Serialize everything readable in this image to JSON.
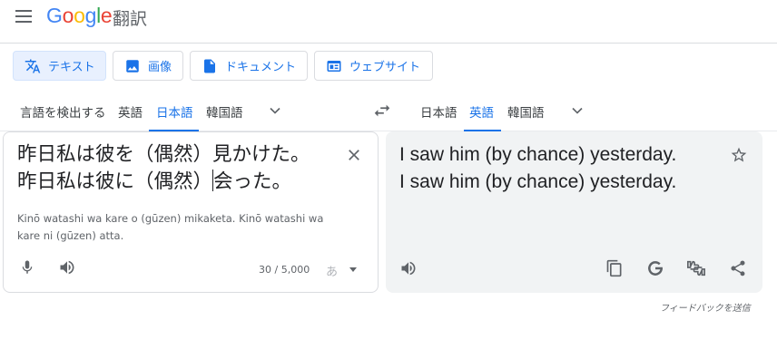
{
  "header": {
    "logo": [
      "G",
      "o",
      "o",
      "g",
      "l",
      "e"
    ],
    "app_name": "翻訳"
  },
  "modes": [
    {
      "label": "テキスト",
      "icon": "translate-icon",
      "active": true
    },
    {
      "label": "画像",
      "icon": "image-icon",
      "active": false
    },
    {
      "label": "ドキュメント",
      "icon": "document-icon",
      "active": false
    },
    {
      "label": "ウェブサイト",
      "icon": "website-icon",
      "active": false
    }
  ],
  "source_langs": [
    "言語を検出する",
    "英語",
    "日本語",
    "韓国語"
  ],
  "source_active": "日本語",
  "target_langs": [
    "日本語",
    "英語",
    "韓国語"
  ],
  "target_active": "英語",
  "source": {
    "line1": "昨日私は彼を（偶然）見かけた。",
    "line2_before_caret": "昨日私は彼に（偶然）",
    "line2_after_caret": "会った。",
    "romanization": "Kinō watashi wa kare o (gūzen) mikaketa. Kinō watashi wa kare ni (gūzen) atta.",
    "char_count": "30 / 5,000",
    "ime_label": "あ"
  },
  "target": {
    "line1": "I saw him (by chance) yesterday.",
    "line2": "I saw him (by chance) yesterday."
  },
  "feedback_label": "フィードバックを送信",
  "colors": {
    "accent": "#1a73e8",
    "active_tab_bg": "#e8f0fe",
    "target_panel_bg": "#f1f3f4",
    "icon_gray": "#5f6368"
  }
}
